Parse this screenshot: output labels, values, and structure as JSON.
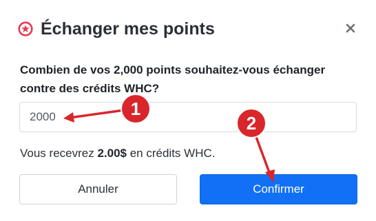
{
  "dialog": {
    "title": "Échanger mes points",
    "close_icon": "close-icon",
    "title_icon": "star-badge-icon",
    "accent_color": "#e8384f"
  },
  "form": {
    "question": "Combien de vos 2,000 points souhaitez-vous échanger contre des crédits WHC?",
    "amount_value": "2000"
  },
  "info": {
    "prefix": "Vous recevrez ",
    "amount": "2.00$",
    "suffix": " en crédits WHC."
  },
  "buttons": {
    "cancel_label": "Annuler",
    "confirm_label": "Confirmer",
    "confirm_color": "#1170f5"
  },
  "annotations": {
    "step1": "1",
    "step2": "2",
    "color": "#d9262b"
  }
}
